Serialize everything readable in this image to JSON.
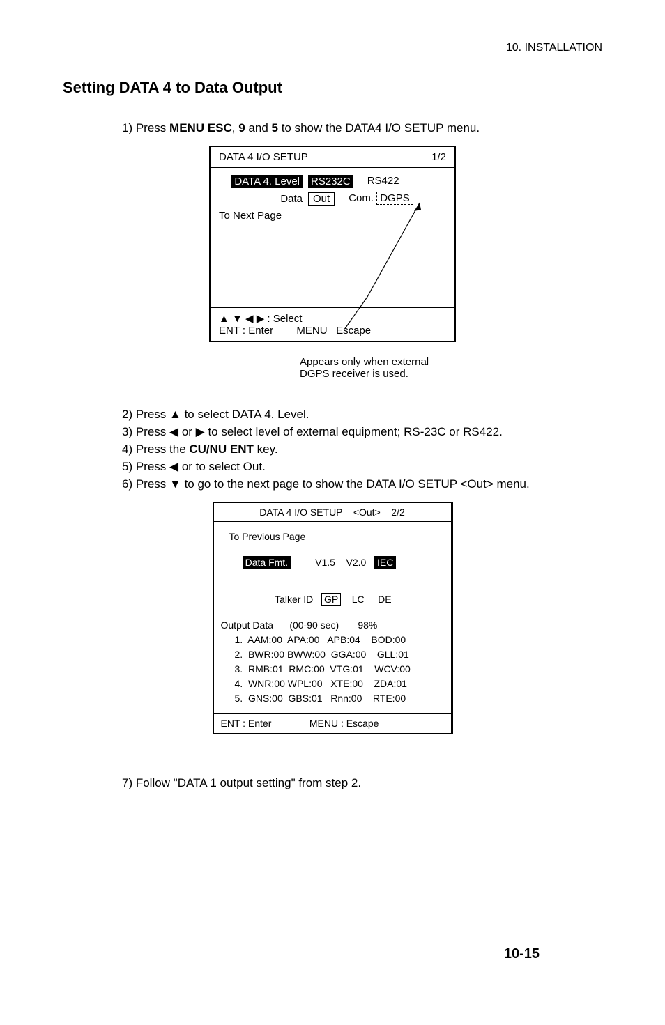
{
  "header": {
    "chapter": "10. INSTALLATION"
  },
  "section_title": "Setting DATA 4 to Data Output",
  "steps": {
    "s1_pre": "1)  Press ",
    "s1_bold1": "MENU ESC",
    "s1_mid1": ", ",
    "s1_bold2": "9",
    "s1_mid2": " and ",
    "s1_bold3": "5",
    "s1_post": " to show the DATA4 I/O SETUP menu.",
    "s2": "2)  Press  ▲  to select DATA 4. Level.",
    "s3": "3)  Press  ◀ or ▶  to select level of external equipment; RS-23C or RS422.",
    "s4_pre": "4)  Press the ",
    "s4_bold": "CU/NU ENT",
    "s4_post": " key.",
    "s5": "5)  Press  ◀ or to select Out.",
    "s6": "6)  Press  ▼  to go to the next page to show the DATA I/O SETUP <Out> menu.",
    "s7": "7)  Follow \"DATA 1 output setting\" from step 2."
  },
  "box1": {
    "title_left": "DATA 4 I/O SETUP",
    "title_right": "1/2",
    "row1_label": "DATA 4. Level",
    "row1_opt1": "RS232C",
    "row1_opt2": "RS422",
    "row2_label": "Data",
    "row2_opt1": "Out",
    "row2_opt2a": "Com.",
    "row2_opt2b": "DGPS",
    "row3": "To Next Page",
    "footer_select": "▲ ▼ ◀ ▶  : Select",
    "footer_enter": "ENT : Enter        MENU   Escape"
  },
  "note": {
    "line1": "Appears only when external",
    "line2": "DGPS receiver is used."
  },
  "box2": {
    "title": "DATA 4 I/O SETUP    <Out>    2/2",
    "prev": "To Previous Page",
    "datafmt_label": "Data Fmt.",
    "datafmt_v15": "V1.5",
    "datafmt_v20": "V2.0",
    "datafmt_iec": "IEC",
    "talker_label": "Talker ID",
    "talker_gp": "GP",
    "talker_lc": "LC",
    "talker_de": "DE",
    "output_line": "Output Data      (00-90 sec)       98%",
    "r1": "1.  AAM:00  APA:00   APB:04    BOD:00",
    "r2": "2.  BWR:00 BWW:00  GGA:00    GLL:01",
    "r3": "3.  RMB:01  RMC:00  VTG:01    WCV:00",
    "r4": "4.  WNR:00 WPL:00   XTE:00    ZDA:01",
    "r5": "5.  GNS:00  GBS:01   Rnn:00    RTE:00",
    "footer": "ENT : Enter              MENU : Escape"
  },
  "page_number": "10-15"
}
